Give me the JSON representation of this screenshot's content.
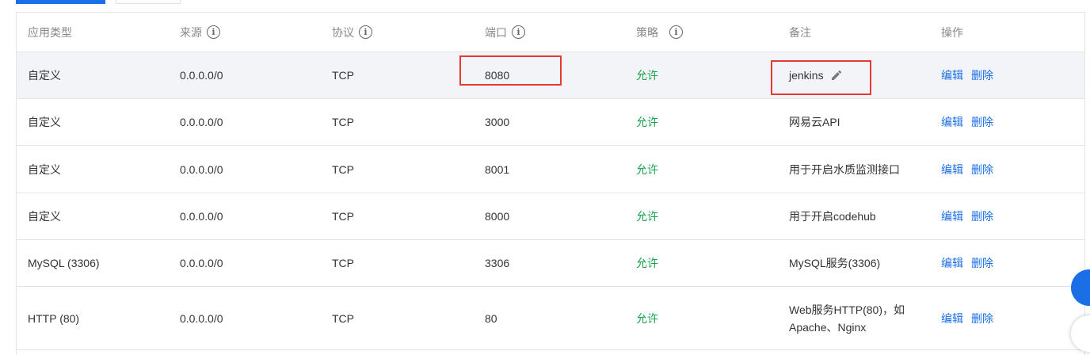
{
  "header": {
    "app_type": "应用类型",
    "source": "来源",
    "protocol": "协议",
    "port": "端口",
    "policy": "策略",
    "remark": "备注",
    "actions": "操作",
    "info_icon_glyph": "i"
  },
  "rows": [
    {
      "app_type": "自定义",
      "source": "0.0.0.0/0",
      "protocol": "TCP",
      "port": "8080",
      "policy": "允许",
      "remark": "jenkins",
      "edit": "编辑",
      "delete": "删除"
    },
    {
      "app_type": "自定义",
      "source": "0.0.0.0/0",
      "protocol": "TCP",
      "port": "3000",
      "policy": "允许",
      "remark": "网易云API",
      "edit": "编辑",
      "delete": "删除"
    },
    {
      "app_type": "自定义",
      "source": "0.0.0.0/0",
      "protocol": "TCP",
      "port": "8001",
      "policy": "允许",
      "remark": "用于开启水质监测接口",
      "edit": "编辑",
      "delete": "删除"
    },
    {
      "app_type": "自定义",
      "source": "0.0.0.0/0",
      "protocol": "TCP",
      "port": "8000",
      "policy": "允许",
      "remark": "用于开启codehub",
      "edit": "编辑",
      "delete": "删除"
    },
    {
      "app_type": "MySQL (3306)",
      "source": "0.0.0.0/0",
      "protocol": "TCP",
      "port": "3306",
      "policy": "允许",
      "remark": "MySQL服务(3306)",
      "edit": "编辑",
      "delete": "删除"
    },
    {
      "app_type": "HTTP (80)",
      "source": "0.0.0.0/0",
      "protocol": "TCP",
      "port": "80",
      "policy": "允许",
      "remark": "Web服务HTTP(80)，如Apache、Nginx",
      "edit": "编辑",
      "delete": "删除"
    }
  ],
  "icons": {
    "info": "info-circle-icon",
    "edit": "pencil-icon"
  },
  "colors": {
    "accent": "#1a6ee6",
    "allow": "#16a34a",
    "highlight": "#e53935"
  }
}
